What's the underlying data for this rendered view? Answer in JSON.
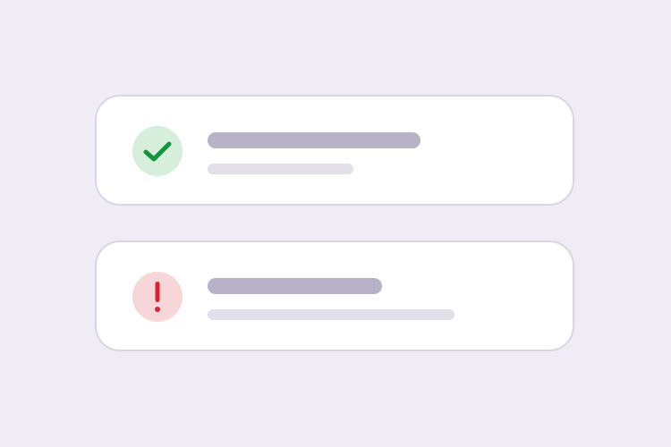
{
  "colors": {
    "background": "#efecf5",
    "card_background": "#ffffff",
    "card_border": "#d9d6e1",
    "title_placeholder": "#b7b2c6",
    "subtitle_placeholder": "#e3e0ea",
    "success_circle": "#d6eedb",
    "success_icon": "#17923e",
    "error_circle": "#f6d6d8",
    "error_icon": "#d62430"
  },
  "notifications": [
    {
      "status": "success",
      "icon": "check-icon"
    },
    {
      "status": "error",
      "icon": "exclamation-icon"
    }
  ]
}
